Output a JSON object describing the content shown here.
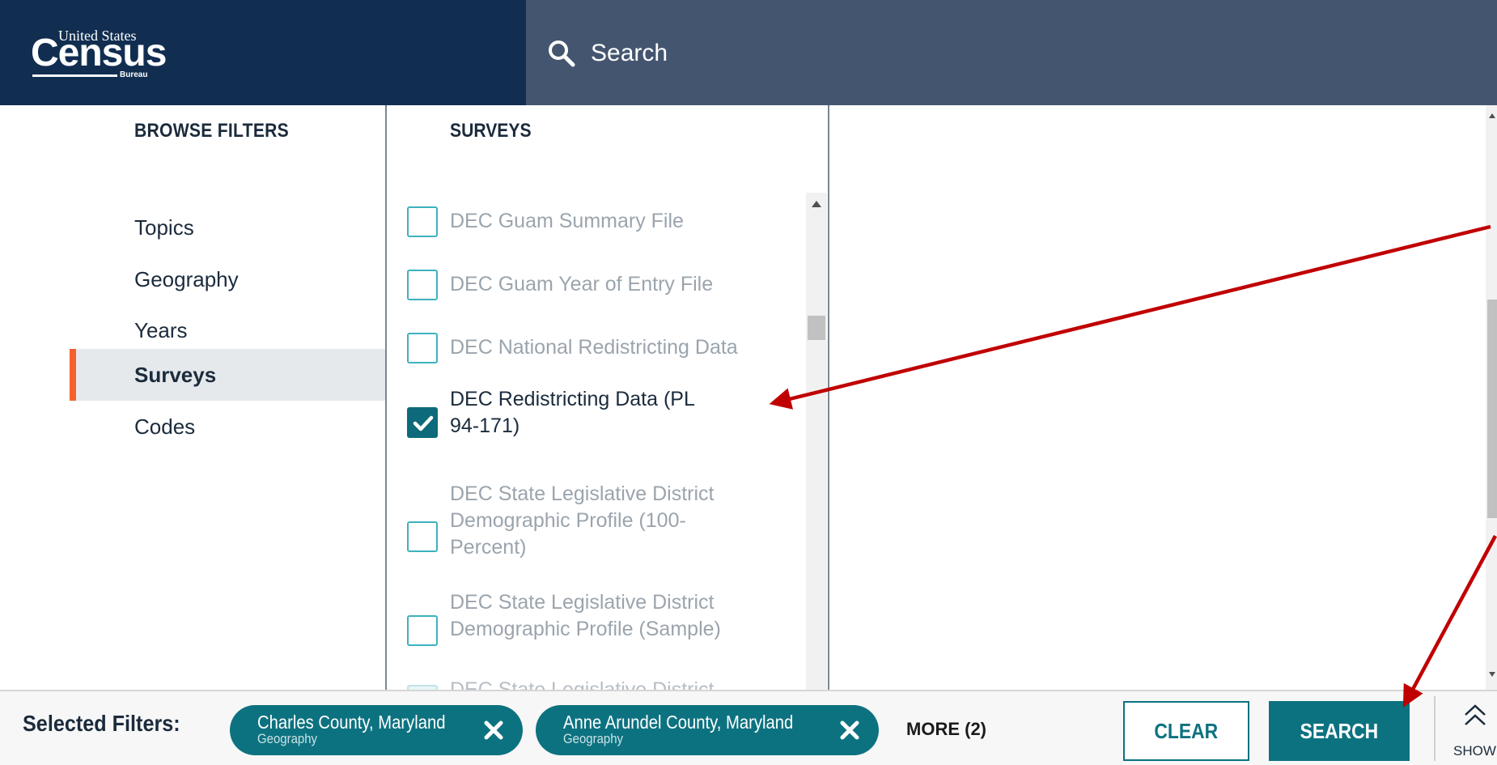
{
  "header": {
    "logo_top": "United States",
    "logo_main": "Census",
    "logo_bureau": "Bureau",
    "search_label": "Search"
  },
  "browse": {
    "title": "BROWSE FILTERS",
    "items": [
      {
        "label": "Topics",
        "active": false
      },
      {
        "label": "Geography",
        "active": false
      },
      {
        "label": "Years",
        "active": false
      },
      {
        "label": "Surveys",
        "active": true
      },
      {
        "label": "Codes",
        "active": false
      }
    ],
    "accent_color": "#f5612c"
  },
  "surveys": {
    "title": "SURVEYS",
    "items": [
      {
        "label": "DEC Guam Summary File",
        "checked": false
      },
      {
        "label": "DEC Guam Year of Entry File",
        "checked": false
      },
      {
        "label": "DEC National Redistricting Data",
        "checked": false
      },
      {
        "label": "DEC Redistricting Data (PL 94-171)",
        "checked": true
      },
      {
        "label": "DEC State Legislative District Demographic Profile (100-Percent)",
        "checked": false
      },
      {
        "label": "DEC State Legislative District Demographic Profile (Sample)",
        "checked": false
      },
      {
        "label": "DEC State Legislative District",
        "checked": false
      }
    ]
  },
  "footer": {
    "selected_label": "Selected Filters:",
    "chips": [
      {
        "title": "Charles County, Maryland",
        "subtitle": "Geography"
      },
      {
        "title": "Anne Arundel County, Maryland",
        "subtitle": "Geography"
      }
    ],
    "more_label": "MORE (2)",
    "clear_label": "CLEAR",
    "search_label": "SEARCH",
    "show_label": "SHOW",
    "chip_color": "#0d7280"
  },
  "colors": {
    "header_dark": "#112e51",
    "header_search": "#44566f",
    "annotation_arrow": "#c00000"
  }
}
